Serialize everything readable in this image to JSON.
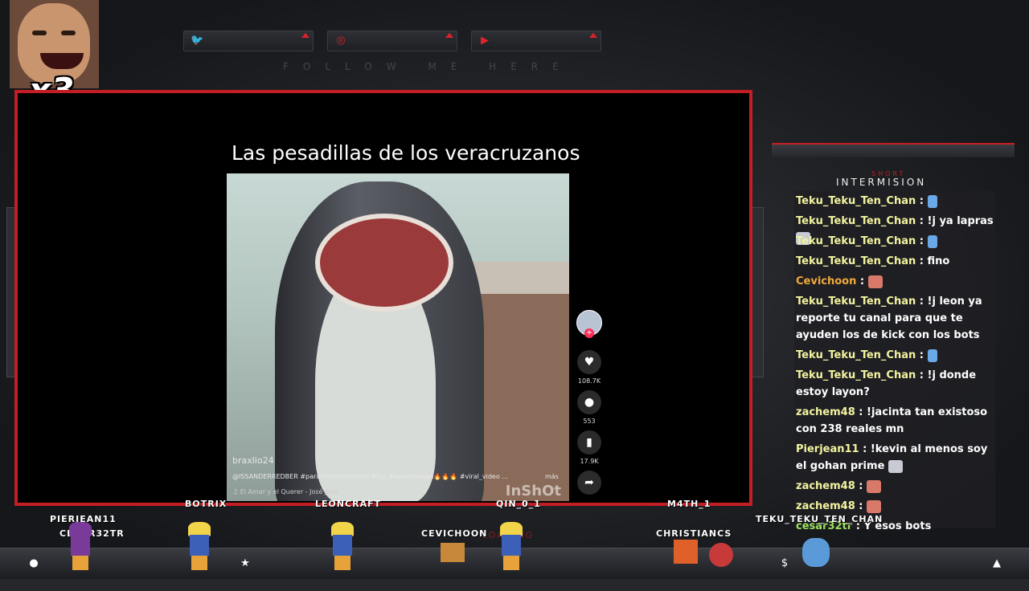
{
  "overlay": {
    "multiplier": "x3",
    "follow_text": "FOLLOW ME HERE",
    "social": [
      {
        "name": "twitter",
        "icon": "twitter-icon",
        "glyph": "🐦"
      },
      {
        "name": "instagram",
        "icon": "instagram-icon",
        "glyph": "◎"
      },
      {
        "name": "youtube",
        "icon": "youtube-icon",
        "glyph": "▶"
      }
    ],
    "chat_title_small": "SHORT",
    "chat_title": "INTERMISION",
    "loading_text": "LOADING"
  },
  "video": {
    "title": "Las pesadillas de los veracruzanos",
    "watermark": "InShOt",
    "username": "braxlio24",
    "description": "@ISSANDERREDBER #paratiiiiiiiiiiiiiiiiiiiiiiiiii #fyp #larachaaaaa🔥🔥🔥 #viral_video ...",
    "more": "más",
    "music": "♫  El Amar y el Querer - José José",
    "likes": "108.7K",
    "comments": "553",
    "saves": "17.9K"
  },
  "chat": [
    {
      "user": "Teku_Teku_Ten_Chan",
      "text": "",
      "emote": "sword"
    },
    {
      "user": "Teku_Teku_Ten_Chan",
      "text": "!j ya lapras",
      "emote": "ghost"
    },
    {
      "user": "Teku_Teku_Ten_Chan",
      "text": "",
      "emote": "sword"
    },
    {
      "user": "Teku_Teku_Ten_Chan",
      "text": "fino",
      "emote": ""
    },
    {
      "user": "Cevichoon",
      "text": "",
      "emote": "face"
    },
    {
      "user": "Teku_Teku_Ten_Chan",
      "text": "!j leon ya reporte tu canal para que te ayuden los de kick con los bots",
      "emote": ""
    },
    {
      "user": "Teku_Teku_Ten_Chan",
      "text": "",
      "emote": "sword"
    },
    {
      "user": "Teku_Teku_Ten_Chan",
      "text": "!j donde estoy layon?",
      "emote": ""
    },
    {
      "user": "zachem48",
      "text": "!jacinta tan existoso con 238 reales mn",
      "emote": ""
    },
    {
      "user": "Pierjean11",
      "text": "!kevin al menos soy el gohan prime",
      "emote": "ghost"
    },
    {
      "user": "zachem48",
      "text": "",
      "emote": "face"
    },
    {
      "user": "zachem48",
      "text": "",
      "emote": "face"
    },
    {
      "user": "cesar32tr",
      "text": "Y esos bots",
      "emote": ""
    }
  ],
  "viewers": [
    "PIERJEAN11",
    "CESAR32TR",
    "BOTRIX",
    "LEONCRAFT",
    "CEVICHOON",
    "QIN_0_1",
    "M4TH_1",
    "CHRISTIANCS",
    "TEKU_TEKU_TEN_CHAN"
  ],
  "bottom_icons": [
    {
      "icon": "user-icon",
      "glyph": "●"
    },
    {
      "icon": "star-icon",
      "glyph": "★"
    },
    {
      "icon": "dollar-icon",
      "glyph": "$"
    },
    {
      "icon": "drop-icon",
      "glyph": "▲"
    }
  ],
  "colors": {
    "accent": "#c41e24"
  }
}
